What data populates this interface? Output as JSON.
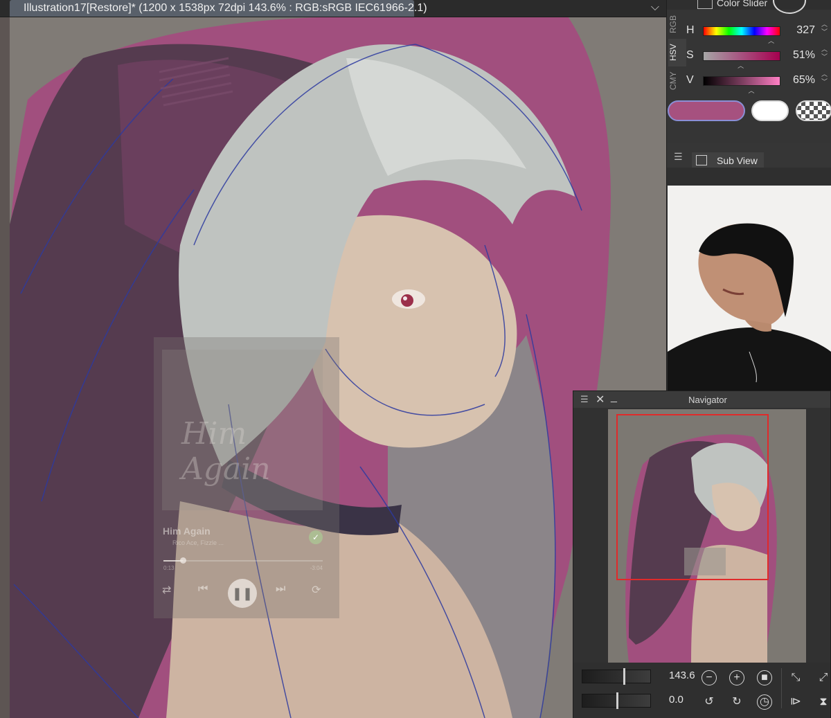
{
  "document_tab": {
    "title": "Illustration17[Restore]* (1200 x 1538px 72dpi 143.6% : RGB:sRGB IEC61966-2.1)"
  },
  "color_panel": {
    "title": "Color Slider",
    "mode_tabs": [
      "RGB",
      "HSV",
      "CMY"
    ],
    "active_mode": "HSV",
    "sliders": [
      {
        "label": "H",
        "value": "327",
        "fraction": 0.91
      },
      {
        "label": "S",
        "value": "51%",
        "fraction": 0.51
      },
      {
        "label": "V",
        "value": "65%",
        "fraction": 0.65
      }
    ],
    "main_color": "#a6517f",
    "sub_color": "#ffffff"
  },
  "subview_panel": {
    "title": "Sub View"
  },
  "navigator": {
    "title": "Navigator",
    "zoom_value": "143.6",
    "rotation_value": "0.0",
    "zoom_fraction": 0.6,
    "rotation_fraction": 0.5
  },
  "player": {
    "album_word": "Him Again",
    "song_title": "Him Again",
    "artist": "Rico Ace, Fizzle ...",
    "elapsed": "0:13",
    "remaining": "-3:04",
    "progress_fraction": 0.12
  },
  "icons": {
    "play_pause": "pause-icon",
    "next": "skip-next-icon",
    "prev": "skip-prev-icon",
    "shuffle": "shuffle-icon",
    "repeat": "repeat-icon"
  }
}
